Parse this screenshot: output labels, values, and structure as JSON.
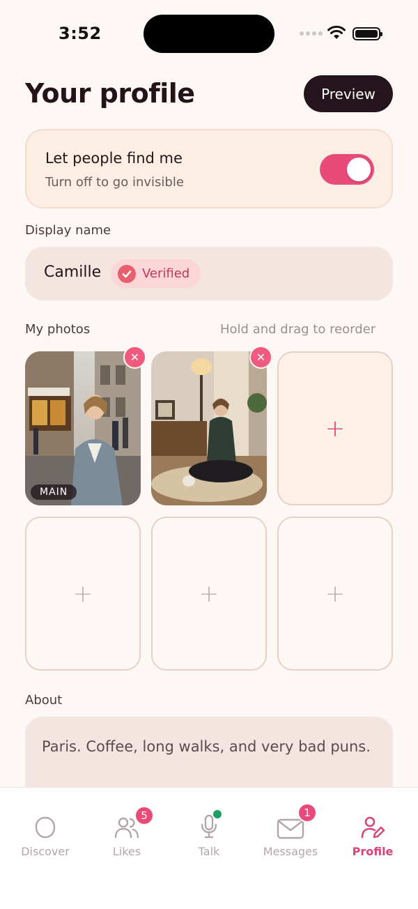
{
  "status_bar": {
    "time": "3:52"
  },
  "header": {
    "title": "Your profile",
    "preview_label": "Preview"
  },
  "visibility": {
    "title": "Let people find me",
    "subtitle": "Turn off to go invisible",
    "enabled": true
  },
  "display_name": {
    "label": "Display name",
    "value": "Camille",
    "badge": "Verified"
  },
  "photos": {
    "label": "My photos",
    "hint": "Hold and drag to reorder",
    "main_badge": "MAIN",
    "slots": [
      {
        "filled": true,
        "main": true,
        "remove_icon": "close-icon"
      },
      {
        "filled": true,
        "main": false,
        "remove_icon": "close-icon"
      },
      {
        "filled": false,
        "add_icon": "plus-icon",
        "accent": true
      },
      {
        "filled": false,
        "add_icon": "plus-icon"
      },
      {
        "filled": false,
        "add_icon": "plus-icon"
      },
      {
        "filled": false,
        "add_icon": "plus-icon"
      }
    ]
  },
  "about": {
    "label": "About",
    "text": "Paris. Coffee, long walks, and very bad puns."
  },
  "tabs": [
    {
      "label": "Discover",
      "icon": "discover-icon"
    },
    {
      "label": "Likes",
      "icon": "people-icon",
      "badge": "5"
    },
    {
      "label": "Talk",
      "icon": "microphone-icon",
      "live": true
    },
    {
      "label": "Messages",
      "icon": "envelope-icon",
      "badge": "1"
    },
    {
      "label": "Profile",
      "icon": "profile-edit-icon",
      "active": true
    }
  ],
  "colors": {
    "accent": "#e84a7a",
    "dark": "#24151c",
    "background": "#fdf8f5"
  }
}
